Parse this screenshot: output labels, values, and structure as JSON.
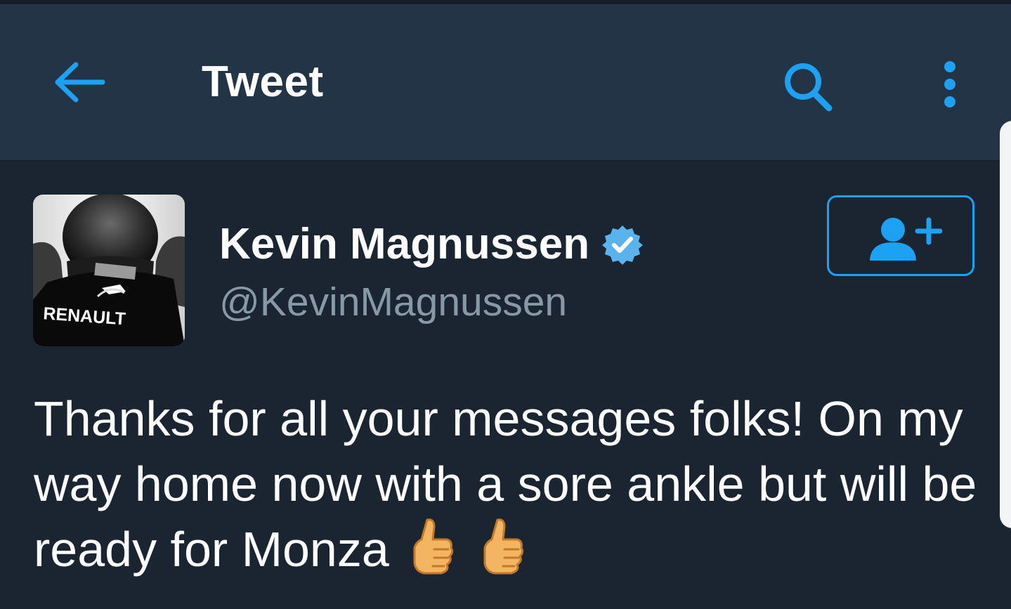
{
  "header": {
    "title": "Tweet",
    "back_icon": "arrow-left-icon",
    "search_icon": "search-icon",
    "menu_icon": "more-vertical-icon"
  },
  "tweet": {
    "author": {
      "display_name": "Kevin Magnussen",
      "handle": "@KevinMagnussen",
      "verified": true,
      "avatar_caption": "RENAULT"
    },
    "follow_icon": "add-user-icon",
    "text": "Thanks for all your messages folks! On my way home now with a sore ankle but will be ready for Monza",
    "emojis": [
      "thumbs-up-icon",
      "thumbs-up-icon"
    ]
  },
  "colors": {
    "header_bg": "#243447",
    "body_bg": "#1b2431",
    "accent": "#1da1f2",
    "handle_text": "#8899a6"
  }
}
